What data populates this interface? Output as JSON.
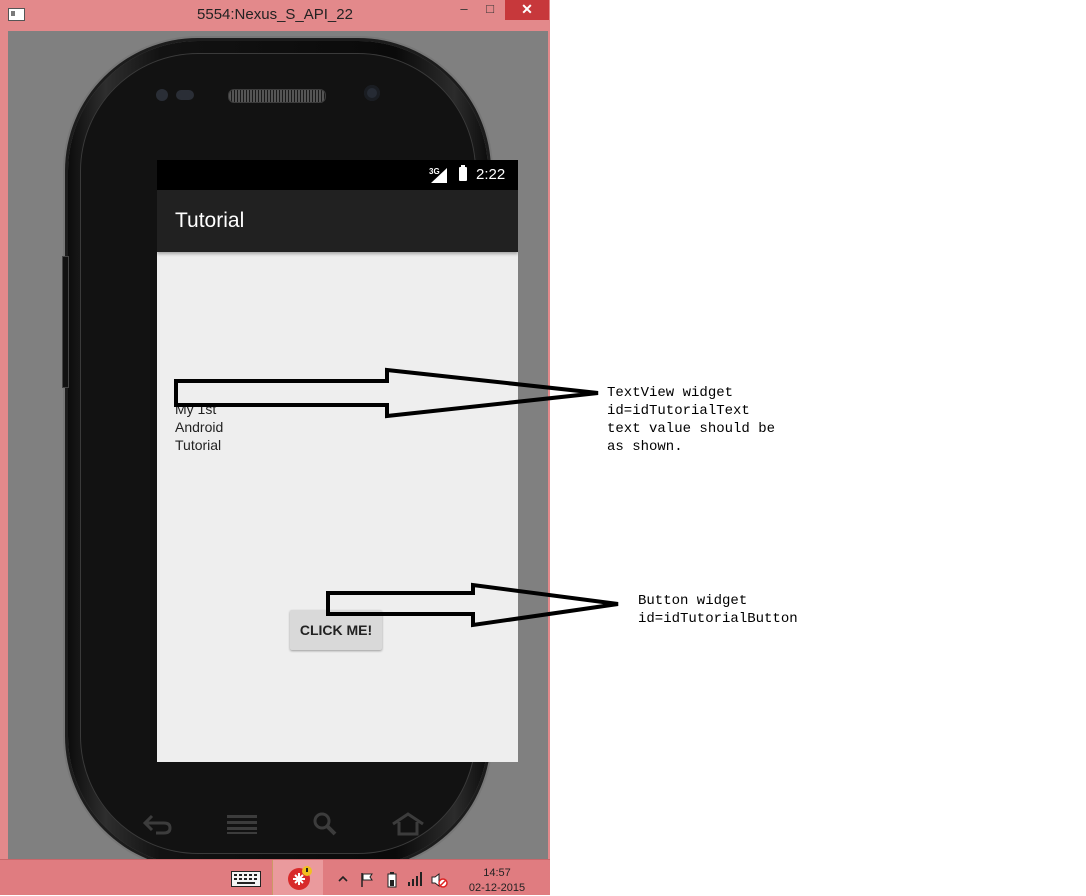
{
  "window": {
    "title": "5554:Nexus_S_API_22",
    "minimize_label": "–",
    "maximize_label": "□",
    "close_label": "✕"
  },
  "statusbar": {
    "network": "3G",
    "time": "2:22"
  },
  "app": {
    "title": "Tutorial",
    "text_view": "My 1st\nAndroid\nTutorial",
    "button_label": "CLICK ME!"
  },
  "navbar": {
    "icons": [
      "back-icon",
      "menu-icon",
      "search-icon",
      "home-icon"
    ]
  },
  "taskbar": {
    "time": "14:57",
    "date": "02-12-2015",
    "icons": [
      "keyboard-icon",
      "app-icon",
      "up-arrow-icon",
      "flag-icon",
      "battery-icon",
      "signal-icon",
      "mute-icon"
    ]
  },
  "annotations": {
    "textview_note": "TextView widget\nid=idTutorialText\ntext value should be\nas shown.",
    "button_note": "Button widget\nid=idTutorialButton"
  },
  "colors": {
    "window_frame": "#e3898b",
    "client_bg": "#808080",
    "app_bar": "#212121",
    "screen_bg": "#eeeeee",
    "button_bg": "#d9d9d9",
    "taskbar": "#e07c80"
  }
}
